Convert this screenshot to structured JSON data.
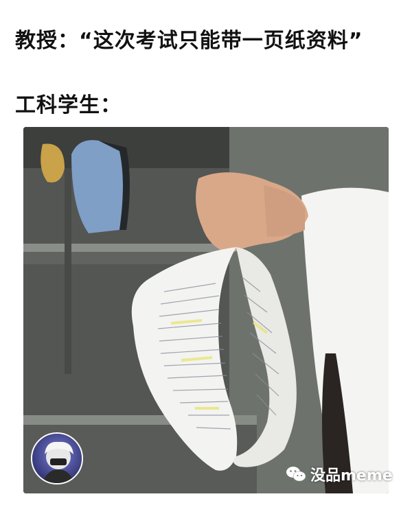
{
  "captions": {
    "professor": "教授：“这次考试只能带一页纸资料”",
    "student": "工科学生："
  },
  "watermark": {
    "brand": "没品meme",
    "icon": "wechat-icon"
  },
  "photo": {
    "subject": "mobius-strip-cheat-sheet"
  }
}
